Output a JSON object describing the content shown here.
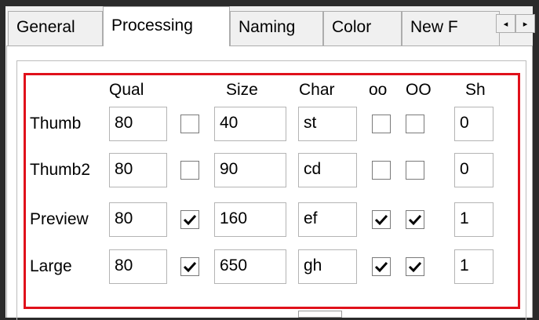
{
  "tabs": [
    {
      "label": "General"
    },
    {
      "label": "Processing"
    },
    {
      "label": "Naming"
    },
    {
      "label": "Color"
    },
    {
      "label": "New F"
    }
  ],
  "tab_scroll": {
    "left": "◂",
    "right": "▸"
  },
  "headers": {
    "qual": "Qual",
    "size": "Size",
    "char": "Char",
    "oo": "oo",
    "OO": "OO",
    "sh": "Sh"
  },
  "rows": [
    {
      "label": "Thumb",
      "qual": "80",
      "qual_checked": false,
      "size": "40",
      "char": "st",
      "oo": false,
      "OO": false,
      "sh": "0"
    },
    {
      "label": "Thumb2",
      "qual": "80",
      "qual_checked": false,
      "size": "90",
      "char": "cd",
      "oo": false,
      "OO": false,
      "sh": "0"
    },
    {
      "label": "Preview",
      "qual": "80",
      "qual_checked": true,
      "size": "160",
      "char": "ef",
      "oo": true,
      "OO": true,
      "sh": "1"
    },
    {
      "label": "Large",
      "qual": "80",
      "qual_checked": true,
      "size": "650",
      "char": "gh",
      "oo": true,
      "OO": true,
      "sh": "1"
    }
  ],
  "colors": {
    "highlight": "#e0111b"
  }
}
